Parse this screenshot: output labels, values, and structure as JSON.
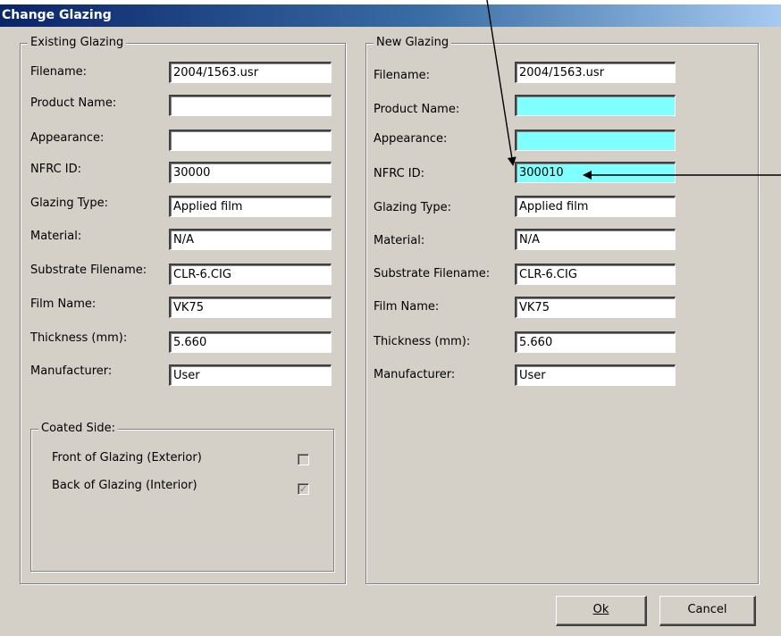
{
  "dialog": {
    "title": "Change Glazing",
    "buttons": {
      "ok": "Ok",
      "cancel": "Cancel"
    }
  },
  "existing": {
    "legend": "Existing Glazing",
    "fields": [
      {
        "label": "Filename:",
        "value": "2004/1563.usr"
      },
      {
        "label": "Product Name:",
        "value": ""
      },
      {
        "label": "Appearance:",
        "value": ""
      },
      {
        "label": "NFRC ID:",
        "value": "30000"
      },
      {
        "label": "Glazing Type:",
        "value": "Applied film"
      },
      {
        "label": "Material:",
        "value": "N/A"
      },
      {
        "label": "Substrate Filename:",
        "value": "CLR-6.CIG"
      },
      {
        "label": "Film Name:",
        "value": "VK75"
      },
      {
        "label": "Thickness (mm):",
        "value": "5.660"
      },
      {
        "label": "Manufacturer:",
        "value": "User"
      }
    ],
    "coated_side": {
      "legend": "Coated Side:",
      "front_label": "Front of Glazing (Exterior)",
      "front_checked": false,
      "back_label": "Back of Glazing (Interior)",
      "back_checked": true
    }
  },
  "new": {
    "legend": "New Glazing",
    "fields": [
      {
        "label": "Filename:",
        "value": "2004/1563.usr"
      },
      {
        "label": "Product Name:",
        "value": ""
      },
      {
        "label": "Appearance:",
        "value": ""
      },
      {
        "label": "NFRC ID:",
        "value": "300010"
      },
      {
        "label": "Glazing Type:",
        "value": "Applied film"
      },
      {
        "label": "Material:",
        "value": "N/A"
      },
      {
        "label": "Substrate Filename:",
        "value": "CLR-6.CIG"
      },
      {
        "label": "Film Name:",
        "value": "VK75"
      },
      {
        "label": "Thickness (mm):",
        "value": "5.660"
      },
      {
        "label": "Manufacturer:",
        "value": "User"
      }
    ]
  },
  "colors": {
    "required_field": "#80ffff",
    "dialog_bg": "#d4d0c8",
    "title_gradient_start": "#0a246a"
  }
}
